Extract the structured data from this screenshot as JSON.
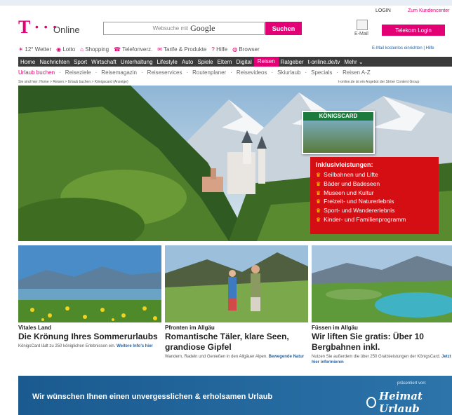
{
  "header": {
    "logo_mark": "T",
    "logo_dots": "• • •",
    "logo_text": "Online",
    "search_placeholder": "Websuche mit",
    "search_brand": "Google",
    "search_button": "Suchen",
    "login_label": "LOGIN",
    "login_link": "Zum Kundencenter",
    "mail_label": "E-Mail",
    "telekom_login": "Telekom Login",
    "mail_notification": "E-Mail kostenlos einrichten | Hilfe"
  },
  "quicklinks": [
    {
      "icon": "weather-icon",
      "label": "12° Wetter"
    },
    {
      "icon": "lotto-icon",
      "label": "Lotto"
    },
    {
      "icon": "cart-icon",
      "label": "Shopping"
    },
    {
      "icon": "phone-icon",
      "label": "Telefonverz."
    },
    {
      "icon": "tariff-icon",
      "label": "Tarife & Produkte"
    },
    {
      "icon": "help-icon",
      "label": "Hilfe"
    },
    {
      "icon": "globe-icon",
      "label": "Browser"
    }
  ],
  "nav": [
    "Home",
    "Nachrichten",
    "Sport",
    "Wirtschaft",
    "Unterhaltung",
    "Lifestyle",
    "Auto",
    "Spiele",
    "Eltern",
    "Digital",
    "Reisen",
    "Ratgeber",
    "t-online.de/tv",
    "Mehr ⌄"
  ],
  "nav_active": "Reisen",
  "subnav": [
    "Urlaub buchen",
    "Reiseziele",
    "Reisemagazin",
    "Reiseservices",
    "Routenplaner",
    "Reisevideos",
    "Skiurlaub",
    "Specials",
    "Reisen A-Z"
  ],
  "subnav_active": "Urlaub buchen",
  "breadcrumb": "Sie sind hier: Home > Reisen > Urlaub buchen > Königscard (Anzeige)",
  "breadcrumb_right": "t-online.de ist ein Angebot der Ströer Content Group",
  "hero": {
    "card_title": "KÖNIGSCARD",
    "inclusive_title": "Inklusivleistungen:",
    "inclusive_items": [
      "Seilbahnen und Lifte",
      "Bäder und Badeseen",
      "Museen und Kultur",
      "Freizeit- und Naturerlebnis",
      "Sport- und Wandererlebnis",
      "Kinder- und Familienprogramm"
    ]
  },
  "tiles": [
    {
      "kicker": "Vitales Land",
      "title": "Die Krönung Ihres Sommerurlaubs",
      "teaser": "KönigsCard lädt zu 250 königlichen Erlebnissen ein.",
      "more": "Weitere Info's hier"
    },
    {
      "kicker": "Pfronten im Allgäu",
      "title": "Romantische Täler, klare Seen, grandiose Gipfel",
      "teaser": "Wandern, Radeln und Genießen in den Allgäuer Alpen.",
      "more": "Bewegende Natur"
    },
    {
      "kicker": "Füssen im Allgäu",
      "title": "Wir liften Sie gratis: Über 10 Bergbahnen inkl.",
      "teaser": "Nutzen Sie außerdem die über 250 Gratisleistungen der KönigsCard.",
      "more": "Jetzt hier informieren"
    }
  ],
  "banner": {
    "text": "Wir wünschen Ihnen einen unvergesslichen & erholsamen Urlaub",
    "presented_by": "präsentiert von:",
    "brand": "Heimat Urlaub"
  },
  "colors": {
    "brand": "#e20074",
    "nav_bg": "#3a3a3a",
    "red_box": "#d50e14",
    "banner": "#1a5a8f"
  }
}
